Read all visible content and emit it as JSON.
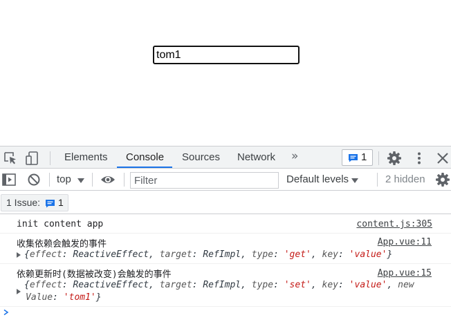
{
  "page": {
    "input_value": "tom1"
  },
  "devtools": {
    "tabs": [
      {
        "label": "Elements",
        "active": false
      },
      {
        "label": "Console",
        "active": true
      },
      {
        "label": "Sources",
        "active": false
      },
      {
        "label": "Network",
        "active": false
      }
    ],
    "more_tabs_glyph": "»",
    "issues_badge_count": "1",
    "icons": {
      "inspect": "inspect-element-icon",
      "device": "device-toolbar-icon",
      "settings": "gear-icon",
      "menu": "vertical-dots-icon",
      "close": "close-icon"
    },
    "accent_color": "#1a73e8"
  },
  "console_toolbar": {
    "context_label": "top",
    "filter_placeholder": "Filter",
    "levels_label": "Default levels",
    "hidden_label": "2 hidden"
  },
  "issues_bar": {
    "label": "1 Issue:",
    "count": "1"
  },
  "log": [
    {
      "message": "init content app",
      "source": "content.js:305"
    },
    {
      "message": "收集依赖会触发的事件",
      "source": "App.vue:11",
      "object": {
        "open": "{",
        "k1": "effect",
        "v1": "ReactiveEffect",
        "k2": "target",
        "v2": "RefImpl",
        "k3": "type",
        "v3": "'get'",
        "k4": "key",
        "v4": "'value'",
        "close": "}"
      }
    },
    {
      "message": "依赖更新时(数据被改变)会触发的事件",
      "source": "App.vue:15",
      "object": {
        "open": "{",
        "k1": "effect",
        "v1": "ReactiveEffect",
        "k2": "target",
        "v2": "RefImpl",
        "k3": "type",
        "v3": "'set'",
        "k4": "key",
        "v4": "'value'",
        "k5a": "new",
        "k5b": "Value",
        "v5": "'tom1'",
        "close": "}"
      }
    }
  ]
}
